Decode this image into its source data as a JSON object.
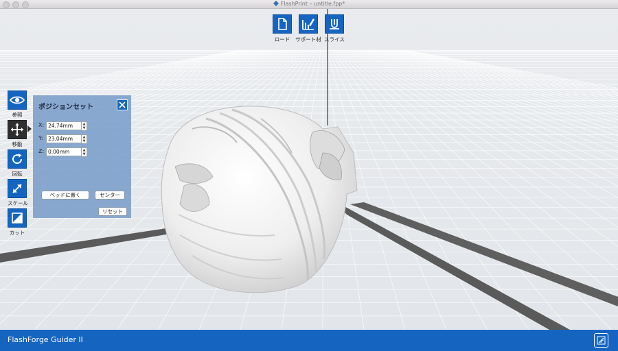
{
  "window": {
    "title": "FlashPrint – untitle.fpp*"
  },
  "toolbar_top": [
    {
      "label": "ロード",
      "icon": "file-icon"
    },
    {
      "label": "サポート材",
      "icon": "support-icon"
    },
    {
      "label": "スライス",
      "icon": "slice-icon"
    }
  ],
  "toolbar_left": [
    {
      "label": "参照",
      "icon": "eye-icon",
      "active": false
    },
    {
      "label": "移動",
      "icon": "move-arrows-icon",
      "active": true
    },
    {
      "label": "回転",
      "icon": "rotate-icon",
      "active": false
    },
    {
      "label": "スケール",
      "icon": "scale-icon",
      "active": false
    },
    {
      "label": "カット",
      "icon": "cut-icon",
      "active": false
    }
  ],
  "position_panel": {
    "title": "ポジションセット",
    "x_label": "X:",
    "x_value": "24.74mm",
    "y_label": "Y:",
    "y_value": "23.04mm",
    "z_label": "Z:",
    "z_value": "0.00mm",
    "bed_button": "ベッドに置く",
    "center_button": "センター",
    "reset_button": "リセット"
  },
  "statusbar": {
    "machine": "FlashForge Guider II",
    "icon": "network-icon"
  },
  "colors": {
    "accent": "#1565c0",
    "panel": "#789cc8",
    "grid_bg": "#e4e7ea",
    "model": "#f0f0f0"
  }
}
